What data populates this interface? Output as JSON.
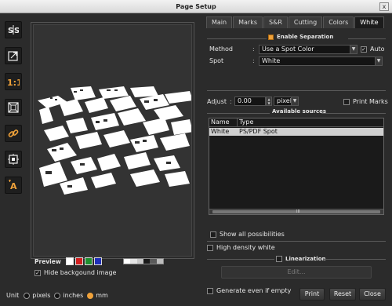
{
  "window": {
    "title": "Page Setup",
    "close_glyph": "x"
  },
  "toolbar": {
    "tools": [
      {
        "name": "mirror-tool-icon"
      },
      {
        "name": "fit-page-icon"
      },
      {
        "name": "actual-size-icon",
        "text": "1:1"
      },
      {
        "name": "fit-window-icon"
      },
      {
        "name": "link-icon"
      },
      {
        "name": "center-icon"
      },
      {
        "name": "text-tool-icon",
        "text": "A"
      }
    ],
    "accent_color": "#f0a23a"
  },
  "preview": {
    "label": "Preview",
    "swatches": [
      "#ffffff",
      "#d21f1f",
      "#1f8f2f",
      "#1f2fb8"
    ],
    "hide_background_label": "Hide backgound image",
    "hide_background_checked": true
  },
  "unit": {
    "label": "Unit",
    "options": [
      "pixels",
      "inches",
      "mm"
    ],
    "selected": "mm"
  },
  "tabs": [
    "Main",
    "Marks",
    "S&R",
    "Cutting",
    "Colors",
    "White"
  ],
  "active_tab": "White",
  "white": {
    "enable_separation_label": "Enable Separation",
    "method_label": "Method",
    "method_value": "Use a Spot Color",
    "auto_label": "Auto",
    "auto_checked": true,
    "spot_label": "Spot",
    "spot_value": "White",
    "adjust_label": "Adjust",
    "adjust_value": "0.00",
    "adjust_unit": "pixel",
    "print_marks_label": "Print Marks",
    "available_sources_label": "Available sources",
    "table_headers": [
      "Name",
      "Type"
    ],
    "table_rows": [
      [
        "White",
        "PS/PDF Spot"
      ]
    ],
    "scroll_grip": "III",
    "show_all_label": "Show all possibilities",
    "high_density_label": "High density white",
    "linearization_label": "Linearization",
    "edit_label": "Edit...",
    "generate_empty_label": "Generate even if empty"
  },
  "buttons": {
    "print": "Print",
    "reset": "Reset",
    "close": "Close"
  }
}
